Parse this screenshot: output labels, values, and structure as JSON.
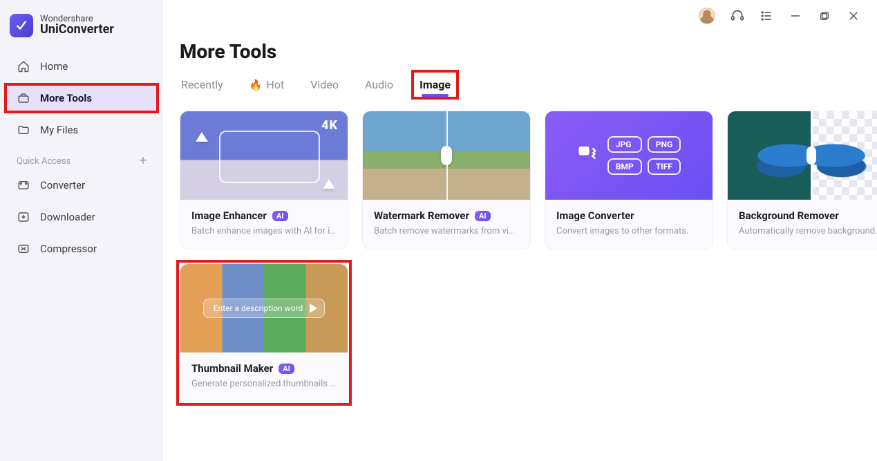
{
  "brand": {
    "top": "Wondershare",
    "bottom": "UniConverter"
  },
  "sidebar": {
    "items": [
      {
        "label": "Home"
      },
      {
        "label": "More Tools"
      },
      {
        "label": "My Files"
      }
    ],
    "quick_access_label": "Quick Access",
    "tools": [
      {
        "label": "Converter"
      },
      {
        "label": "Downloader"
      },
      {
        "label": "Compressor"
      }
    ]
  },
  "page": {
    "title": "More Tools"
  },
  "tabs": [
    {
      "label": "Recently"
    },
    {
      "label": "Hot"
    },
    {
      "label": "Video"
    },
    {
      "label": "Audio"
    },
    {
      "label": "Image"
    }
  ],
  "cards": [
    {
      "title": "Image Enhancer",
      "ai": "AI",
      "desc": "Batch enhance images with AI for i…",
      "badge4k": "4K"
    },
    {
      "title": "Watermark Remover",
      "ai": "AI",
      "desc": "Batch remove watermarks from vi…"
    },
    {
      "title": "Image Converter",
      "desc": "Convert images to other formats.",
      "formats": [
        "JPG",
        "PNG",
        "BMP",
        "TIFF"
      ]
    },
    {
      "title": "Background Remover",
      "desc": "Automatically remove background…"
    },
    {
      "title": "Thumbnail Maker",
      "ai": "AI",
      "desc": "Generate personalized thumbnails …",
      "prompt": "Enter a description word"
    }
  ]
}
